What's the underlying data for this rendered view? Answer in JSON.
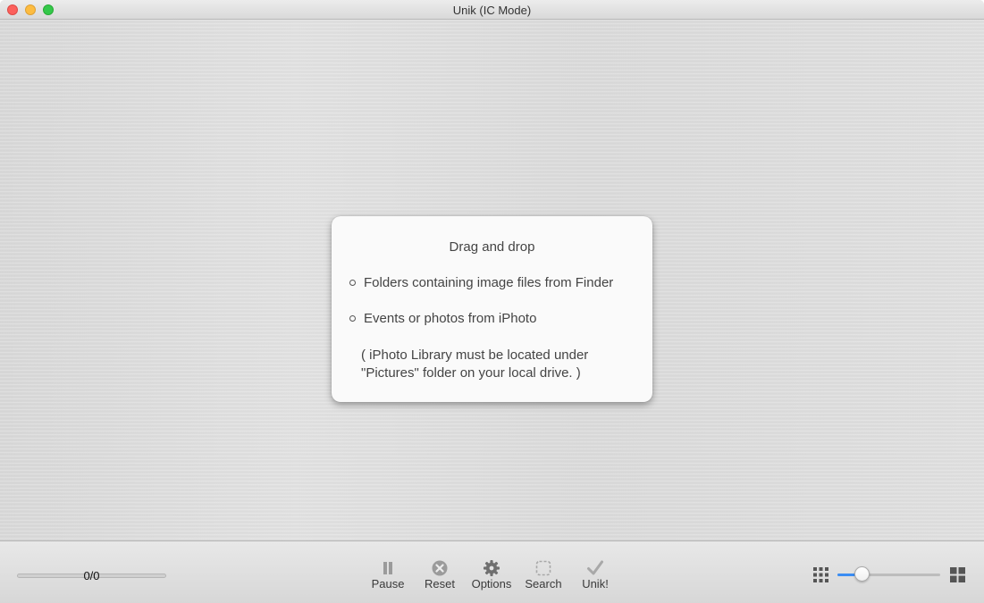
{
  "window": {
    "title": "Unik (IC Mode)",
    "controls": [
      "close",
      "minimize",
      "zoom"
    ]
  },
  "drop_zone": {
    "heading": "Drag and drop",
    "items": [
      "Folders containing image files from Finder",
      "Events or photos from iPhoto"
    ],
    "note_lines": [
      "( iPhoto Library must be located under",
      "\"Pictures\" folder on your local drive. )"
    ]
  },
  "status": {
    "progress_text": "0/0",
    "progress": 0
  },
  "toolbar": {
    "pause": {
      "label": "Pause",
      "icon": "pause-icon"
    },
    "reset": {
      "label": "Reset",
      "icon": "reset-icon"
    },
    "options": {
      "label": "Options",
      "icon": "gear-icon"
    },
    "search": {
      "label": "Search",
      "icon": "search-dashed-icon"
    },
    "unik": {
      "label": "Unik!",
      "icon": "checkmark-icon"
    }
  },
  "thumbnail_size": {
    "level": 0.24,
    "small_icon": "small-grid-icon",
    "large_icon": "large-grid-icon",
    "accent_color": "#3b8df3"
  }
}
